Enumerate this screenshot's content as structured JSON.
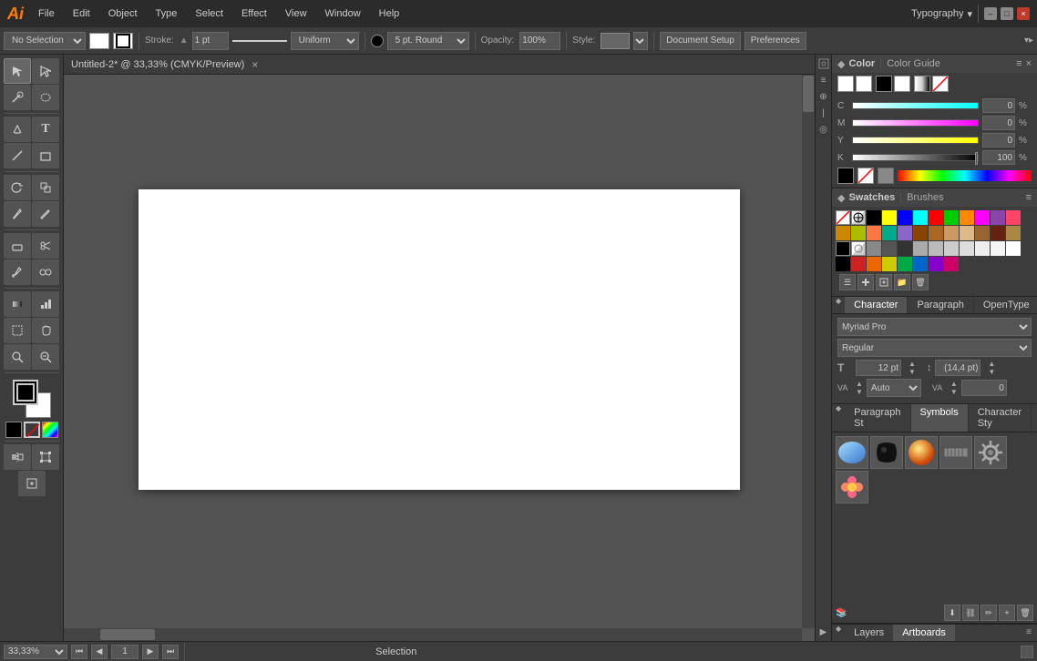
{
  "titlebar": {
    "app_name": "Ai",
    "menus": [
      "File",
      "Edit",
      "Object",
      "Type",
      "Select",
      "Effect",
      "View",
      "Window",
      "Help"
    ],
    "workspace": "Typography",
    "document_title": "Untitled-2* @ 33,33% (CMYK/Preview)",
    "close_icon": "×",
    "minimize_icon": "–",
    "maximize_icon": "□"
  },
  "toolbar": {
    "selection_label": "No Selection",
    "fill_color": "#ffffff",
    "stroke_label": "Stroke:",
    "stroke_width": "1 pt",
    "stroke_type": "Uniform",
    "brush_label": "5 pt. Round",
    "opacity_label": "Opacity:",
    "opacity_value": "100%",
    "style_label": "Style:",
    "doc_setup_btn": "Document Setup",
    "preferences_btn": "Preferences"
  },
  "tools": [
    {
      "name": "selection",
      "icon": "↖",
      "title": "Selection Tool"
    },
    {
      "name": "direct-selection",
      "icon": "↗",
      "title": "Direct Selection"
    },
    {
      "name": "magic-wand",
      "icon": "✦",
      "title": "Magic Wand"
    },
    {
      "name": "lasso",
      "icon": "⊙",
      "title": "Lasso"
    },
    {
      "name": "pen",
      "icon": "✒",
      "title": "Pen"
    },
    {
      "name": "type",
      "icon": "T",
      "title": "Type"
    },
    {
      "name": "line",
      "icon": "╲",
      "title": "Line"
    },
    {
      "name": "rectangle",
      "icon": "□",
      "title": "Rectangle"
    },
    {
      "name": "rotate",
      "icon": "↻",
      "title": "Rotate"
    },
    {
      "name": "scale",
      "icon": "⤢",
      "title": "Scale"
    },
    {
      "name": "paintbrush",
      "icon": "✎",
      "title": "Paintbrush"
    },
    {
      "name": "pencil",
      "icon": "✏",
      "title": "Pencil"
    },
    {
      "name": "eraser",
      "icon": "◻",
      "title": "Eraser"
    },
    {
      "name": "scissors",
      "icon": "✂",
      "title": "Scissors"
    },
    {
      "name": "eyedropper",
      "icon": "💉",
      "title": "Eyedropper"
    },
    {
      "name": "blend",
      "icon": "◈",
      "title": "Blend"
    },
    {
      "name": "gradient",
      "icon": "▦",
      "title": "Gradient"
    },
    {
      "name": "graph",
      "icon": "📊",
      "title": "Graph"
    },
    {
      "name": "artboard",
      "icon": "⊞",
      "title": "Artboard"
    },
    {
      "name": "hand",
      "icon": "✋",
      "title": "Hand"
    },
    {
      "name": "zoom",
      "icon": "🔍",
      "title": "Zoom"
    }
  ],
  "color_panel": {
    "title": "Color",
    "guide_tab": "Color Guide",
    "channels": [
      {
        "label": "C",
        "value": "0",
        "pct": "%"
      },
      {
        "label": "M",
        "value": "0",
        "pct": "%"
      },
      {
        "label": "Y",
        "value": "0",
        "pct": "%"
      },
      {
        "label": "K",
        "value": "100",
        "pct": "%"
      }
    ]
  },
  "swatches_panel": {
    "title": "Swatches",
    "brushes_tab": "Brushes",
    "swatches": [
      [
        "#ff4444",
        "#ffffff",
        "#000000",
        "#ffff00",
        "#00ffff",
        "#ff00ff",
        "#0000ff",
        "#00ff00"
      ],
      [
        "#ff8800",
        "#ffaa00",
        "#88ff00",
        "#00ff88",
        "#0088ff",
        "#8800ff",
        "#ff0088",
        "#888888"
      ],
      [
        "#664400",
        "#886600",
        "#448800",
        "#006644",
        "#004488",
        "#440088",
        "#880044",
        "#444444"
      ],
      [
        "#ffccaa",
        "#ffffaa",
        "#aaffaa",
        "#aaffff",
        "#aaaaff",
        "#ffaaff",
        "#ffaaaa",
        "#ffffff"
      ],
      [
        "#000000",
        "#888888",
        "#aaaaaa",
        "#cccccc",
        "#dddddd",
        "#eeeeee",
        "#ffffff",
        "#f5f5f5"
      ]
    ]
  },
  "character_panel": {
    "title": "Character",
    "paragraph_tab": "Paragraph",
    "opentype_tab": "OpenType",
    "font_name": "Myriad Pro",
    "font_style": "Regular",
    "font_size": "12 pt",
    "leading": "(14,4 pt)",
    "tracking": "Auto",
    "kerning": "0"
  },
  "symbols_tabs": {
    "paragraph_styles": "Paragraph St",
    "symbols": "Symbols",
    "character_styles": "Character Sty"
  },
  "bottom_bar": {
    "zoom": "33,33%",
    "page": "1",
    "status": "Selection"
  },
  "layers_tabs": {
    "layers": "Layers",
    "artboards": "Artboards"
  },
  "document": {
    "title": "Untitled-2* @ 33,33% (CMYK/Preview)",
    "close": "×"
  }
}
